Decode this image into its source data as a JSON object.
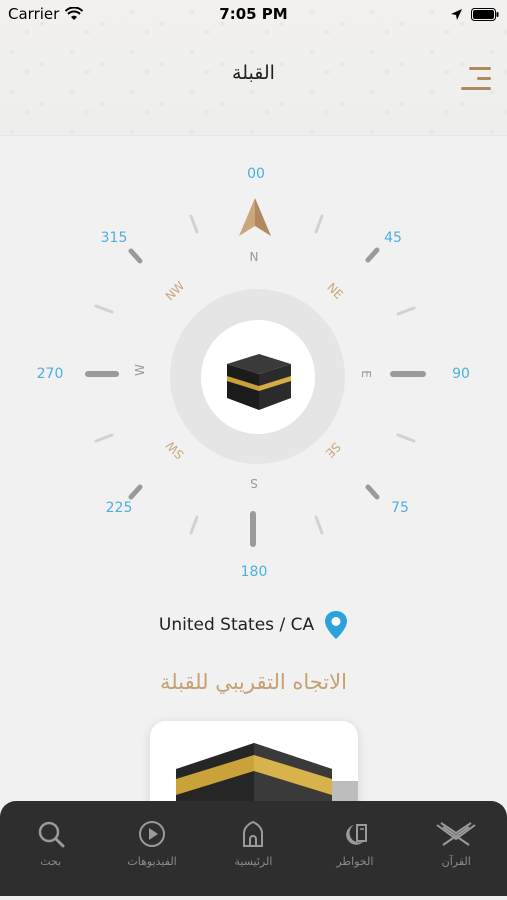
{
  "status_bar": {
    "carrier": "Carrier",
    "time": "7:05 PM"
  },
  "header": {
    "title": "القبلة"
  },
  "compass": {
    "degree_labels": [
      "00",
      "45",
      "90",
      "75",
      "180",
      "225",
      "270",
      "315"
    ],
    "direction_labels": [
      "N",
      "NE",
      "E",
      "SE",
      "S",
      "SW",
      "W",
      "NW"
    ]
  },
  "location": {
    "text": "United States / CA"
  },
  "direction_title": "الاتجاه التقريبي للقبلة",
  "tabs": [
    {
      "label": "بحث",
      "icon": "search-icon"
    },
    {
      "label": "الفيديوهات",
      "icon": "play-icon"
    },
    {
      "label": "الرئيسية",
      "icon": "mosque-icon"
    },
    {
      "label": "الخواطر",
      "icon": "crescent-book-icon"
    },
    {
      "label": "القرآن",
      "icon": "quran-stand-icon"
    }
  ],
  "colors": {
    "accent": "#b08a5f",
    "degree": "#4bb0e0",
    "tabbar": "#2e2e2e"
  }
}
